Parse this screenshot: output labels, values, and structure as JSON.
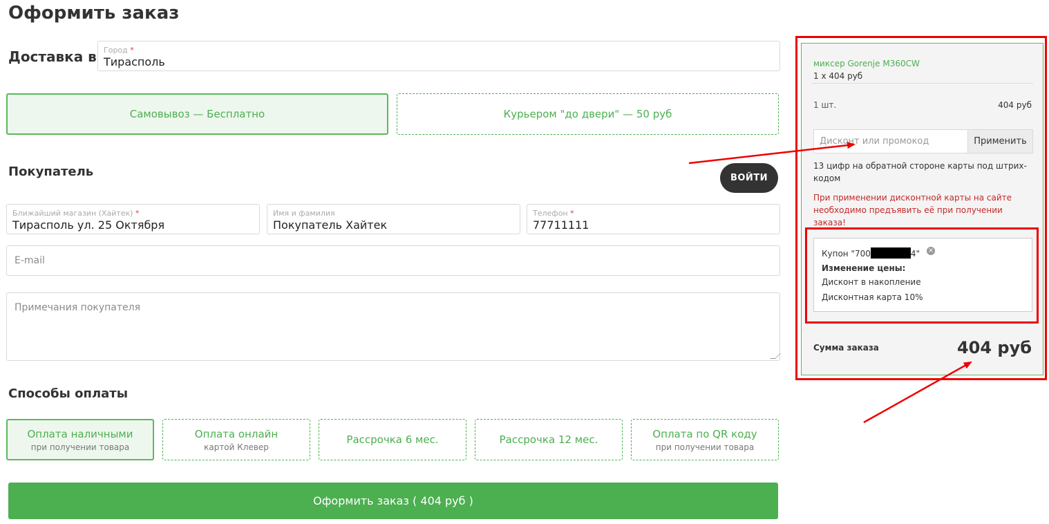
{
  "page": {
    "title": "Оформить заказ"
  },
  "delivery": {
    "label": "Доставка в",
    "city_label": "Город",
    "required_mark": "*",
    "city_value": "Тирасполь",
    "options": [
      {
        "label": "Самовывоз — Бесплатно",
        "selected": true
      },
      {
        "label": "Курьером \"до двери\" — 50 руб",
        "selected": false
      }
    ]
  },
  "buyer": {
    "title": "Покупатель",
    "login_label": "ВОЙТИ",
    "store_label": "Ближайший магазин (Хайтек)",
    "store_value": "Тирасполь ул. 25 Октября",
    "name_label": "Имя и фамилия",
    "name_value": "Покупатель Хайтек",
    "phone_label": "Телефон",
    "phone_value": "77711111",
    "email_placeholder": "E-mail",
    "notes_placeholder": "Примечания покупателя"
  },
  "payment": {
    "title": "Способы оплаты",
    "methods": [
      {
        "label": "Оплата наличными",
        "sub": "при получении товара",
        "selected": true
      },
      {
        "label": "Оплата онлайн",
        "sub": "картой Клевер",
        "selected": false
      },
      {
        "label": "Рассрочка 6 мес.",
        "sub": "",
        "selected": false
      },
      {
        "label": "Рассрочка 12 мес.",
        "sub": "",
        "selected": false
      },
      {
        "label": "Оплата по QR коду",
        "sub": "при получении товара",
        "selected": false
      }
    ]
  },
  "submit": {
    "label": "Оформить заказ ( 404 руб )"
  },
  "cart": {
    "item_name": "миксер Gorenje M360CW",
    "item_qty_price": "1 x 404 руб",
    "qty_count": "1 шт.",
    "qty_sum": "404 руб",
    "promo_placeholder": "Дисконт или промокод",
    "apply_label": "Применить",
    "promo_hint": "13 цифр на обратной стороне карты под штрих-кодом",
    "promo_warning": "При применении дисконтной карты на сайте необходимо предъявить её при получении заказа!",
    "coupon": {
      "prefix": "Купон \"700",
      "suffix": "4\"",
      "price_change": "Изменение цены:",
      "line1": "Дисконт в накопление",
      "line2": "Дисконтная карта 10%"
    },
    "total_label": "Сумма заказа",
    "total_value": "404 руб"
  },
  "colors": {
    "accent": "#4caf50",
    "annotation": "#ee0000",
    "warning": "#c62828",
    "dark_button": "#333333"
  },
  "icons": {
    "coupon_remove": "close-circle-icon"
  }
}
